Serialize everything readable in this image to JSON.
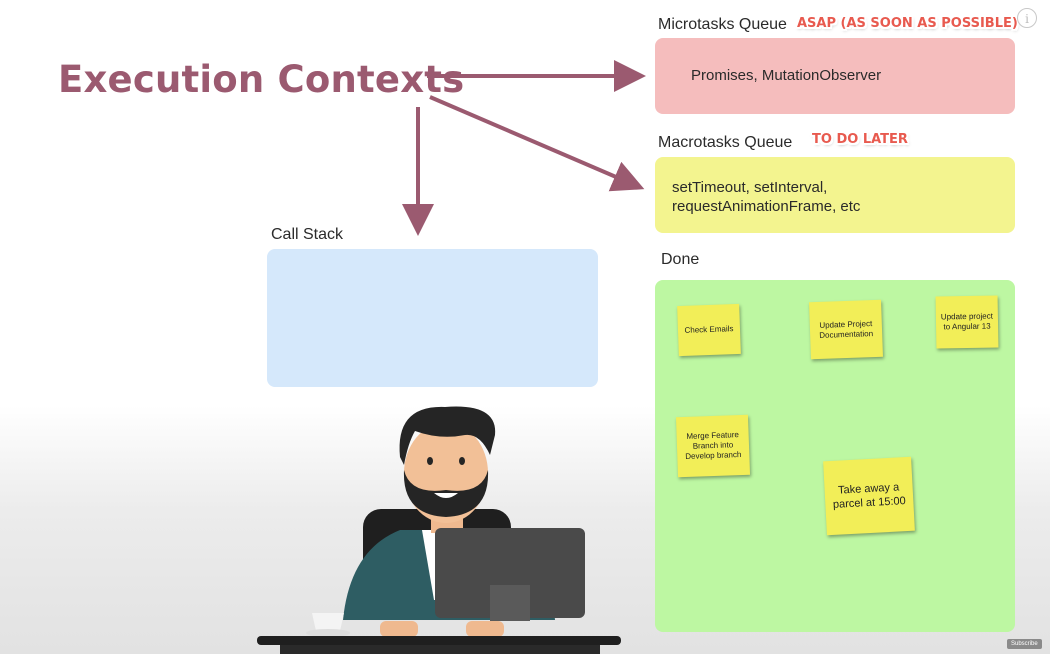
{
  "title": "Execution Contexts",
  "microtasks": {
    "label": "Microtasks Queue",
    "tag": "ASAP (AS SOON AS POSSIBLE)",
    "content": "Promises, MutationObserver",
    "color": "#f5bdbd"
  },
  "macrotasks": {
    "label": "Macrotasks Queue",
    "tag": "TO DO LATER",
    "line1": "setTimeout, setInterval,",
    "line2": "requestAnimationFrame, etc",
    "color": "#f3f48f"
  },
  "call_stack": {
    "label": "Call Stack",
    "color": "#d5e8fb"
  },
  "done": {
    "label": "Done",
    "color": "#bdf7a2",
    "notes": [
      "Check Emails",
      "Update Project Documentation",
      "Update project to Angular 13",
      "Merge Feature Branch into Develop branch",
      "Take away a parcel at 15:00"
    ]
  },
  "overlay": {
    "info_icon": "info-icon",
    "subscribe": "Subscribe"
  },
  "colors": {
    "title": "#9b5a70",
    "arrows": "#9b5a70",
    "tags": "#e85a4f"
  }
}
